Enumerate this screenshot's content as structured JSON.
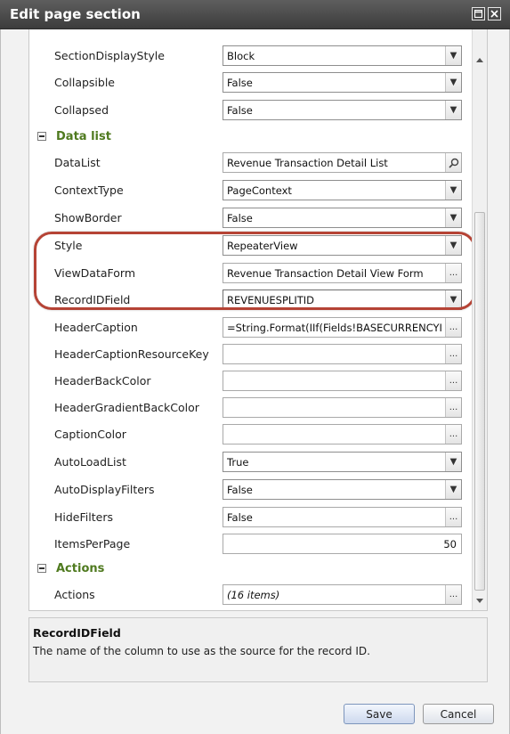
{
  "window": {
    "title": "Edit page section"
  },
  "rows_top": [
    {
      "label": "SectionDisplayStyle",
      "value": "Block",
      "control": "dropdown"
    },
    {
      "label": "Collapsible",
      "value": "False",
      "control": "dropdown"
    },
    {
      "label": "Collapsed",
      "value": "False",
      "control": "dropdown"
    }
  ],
  "sections": {
    "data_list": {
      "title": "Data list"
    },
    "actions": {
      "title": "Actions"
    }
  },
  "rows_data_list": [
    {
      "label": "DataList",
      "value": "Revenue Transaction Detail List",
      "control": "search"
    },
    {
      "label": "ContextType",
      "value": "PageContext",
      "control": "dropdown"
    },
    {
      "label": "ShowBorder",
      "value": "False",
      "control": "dropdown"
    },
    {
      "label": "Style",
      "value": "RepeaterView",
      "control": "dropdown"
    },
    {
      "label": "ViewDataForm",
      "value": "Revenue Transaction Detail View Form",
      "control": "ellipsis"
    },
    {
      "label": "RecordIDField",
      "value": "REVENUESPLITID",
      "control": "dropdown"
    },
    {
      "label": "HeaderCaption",
      "value": "=String.Format(IIf(Fields!BASECURRENCYID <",
      "control": "ellipsis"
    },
    {
      "label": "HeaderCaptionResourceKey",
      "value": "",
      "control": "ellipsis"
    },
    {
      "label": "HeaderBackColor",
      "value": "",
      "control": "ellipsis"
    },
    {
      "label": "HeaderGradientBackColor",
      "value": "",
      "control": "ellipsis"
    },
    {
      "label": "CaptionColor",
      "value": "",
      "control": "ellipsis"
    },
    {
      "label": "AutoLoadList",
      "value": "True",
      "control": "dropdown"
    },
    {
      "label": "AutoDisplayFilters",
      "value": "False",
      "control": "dropdown"
    },
    {
      "label": "HideFilters",
      "value": "False",
      "control": "ellipsis"
    },
    {
      "label": "ItemsPerPage",
      "value": "50",
      "control": "number"
    }
  ],
  "rows_actions": [
    {
      "label": "Actions",
      "value": "(16 items)",
      "control": "ellipsis"
    }
  ],
  "description": {
    "title": "RecordIDField",
    "text": "The name of the column to use as the source for the record ID."
  },
  "buttons": {
    "save": "Save",
    "cancel": "Cancel"
  },
  "glyphs": {
    "ellipsis": "...",
    "dropdown": "▼",
    "search": "⚲"
  },
  "colors": {
    "section_title": "#4f7a1f",
    "highlight": "#b54335",
    "titlebar": "#4a4a4a"
  }
}
